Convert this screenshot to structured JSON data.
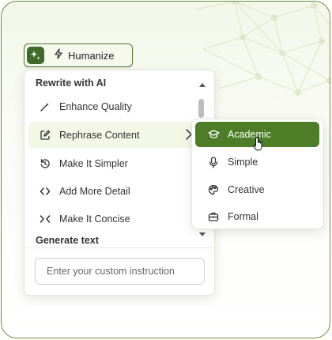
{
  "toolbar": {
    "humanize_label": "Humanize"
  },
  "menu": {
    "section_rewrite": "Rewrite with AI",
    "items": [
      {
        "label": "Enhance Quality",
        "icon": "pen-sparkle-icon"
      },
      {
        "label": "Rephrase Content",
        "icon": "edit-square-icon"
      },
      {
        "label": "Make It Simpler",
        "icon": "clock-arrow-icon"
      },
      {
        "label": "Add More Detail",
        "icon": "expand-arrows-icon"
      },
      {
        "label": "Make It Concise",
        "icon": "collapse-arrows-icon"
      }
    ],
    "section_generate": "Generate text",
    "custom_input_placeholder": "Enter your custom instruction"
  },
  "submenu": {
    "items": [
      {
        "label": "Academic",
        "icon": "graduation-cap-icon",
        "selected": true
      },
      {
        "label": "Simple",
        "icon": "microphone-icon",
        "selected": false
      },
      {
        "label": "Creative",
        "icon": "palette-icon",
        "selected": false
      },
      {
        "label": "Formal",
        "icon": "briefcase-icon",
        "selected": false
      }
    ]
  },
  "colors": {
    "accent": "#4d7d27",
    "frame_border": "#6b8f3e",
    "active_row": "#f2f7e6"
  }
}
